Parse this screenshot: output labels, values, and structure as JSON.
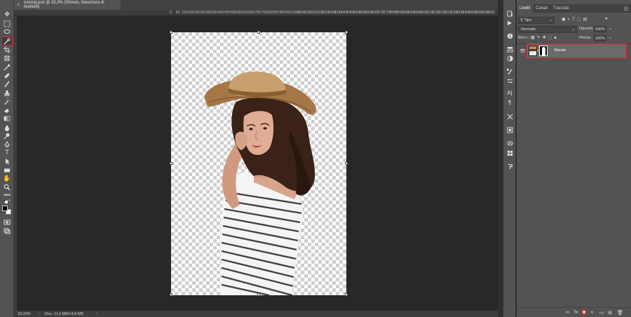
{
  "document_tab": {
    "title": "tutorial.psd @ 33,3% (Sfondo, Maschera di livello/8)",
    "close": "×"
  },
  "ruler": {
    "ticks": [
      "0",
      "50",
      "100",
      "150",
      "200",
      "250",
      "300",
      "350",
      "400",
      "450",
      "500",
      "550",
      "600",
      "650",
      "700",
      "750",
      "800",
      "850",
      "900",
      "950",
      "1000",
      "1050",
      "1100",
      "1150",
      "1200",
      "1250",
      "1300",
      "1350",
      "1400",
      "1450",
      "1500",
      "1550",
      "1600",
      "1650",
      "1700",
      "1750",
      "1800",
      "1850",
      "1900",
      "1950",
      "2000",
      "2050",
      "2100",
      "2150",
      "2200",
      "2250",
      "2300",
      "2350",
      "2400",
      "2450",
      "2500",
      "2550",
      "2600",
      "2650",
      "2700",
      "2750",
      "2800",
      "2850",
      "2900"
    ]
  },
  "statusbar": {
    "zoom": "33,33%",
    "docinfo": "Doc: 11,0 MB/14,8 MB",
    "arrow": "›"
  },
  "layers_panel": {
    "tabs": [
      "Livelli",
      "Canali",
      "Tracciati"
    ],
    "active_tab": "Livelli",
    "filter_kind": "Tipo",
    "blend_mode": "Normale",
    "opacity_label": "Opacità:",
    "opacity_value": "100%",
    "lock_label": "Blocc.:",
    "fill_label": "Riemp.:",
    "fill_value": "100%",
    "layer": {
      "name": "Sfondo",
      "selected": true,
      "visible": true
    }
  },
  "highlight_color": "#e0242a"
}
